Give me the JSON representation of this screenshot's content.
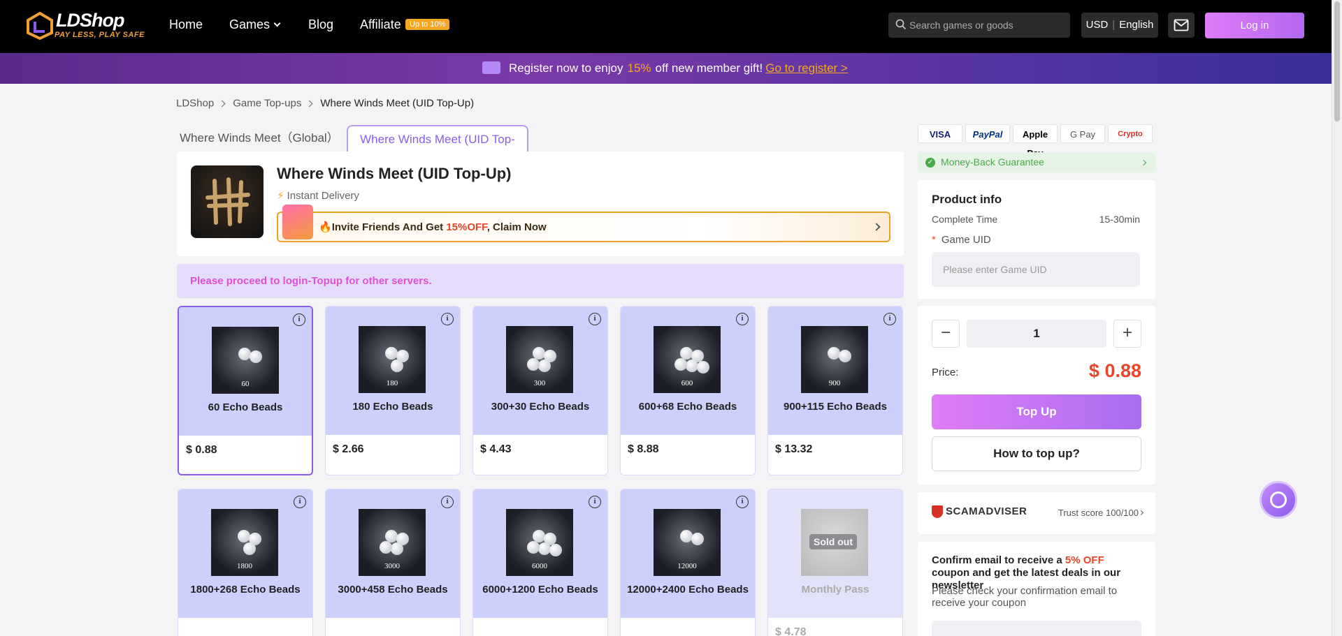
{
  "header": {
    "logo_text": "LDShop",
    "logo_tagline": "PAY LESS, PLAY SAFE",
    "nav": [
      {
        "label": "Home"
      },
      {
        "label": "Games"
      },
      {
        "label": "Blog"
      },
      {
        "label": "Affiliate"
      }
    ],
    "affiliate_badge": "Up to 10%",
    "search_placeholder": "Search games or goods",
    "currency": "USD",
    "language": "English",
    "login_label": "Log in"
  },
  "promo": {
    "text_before": "Register now to enjoy",
    "percent": "15%",
    "text_after": "off new member gift!",
    "link": "Go to register >",
    "icon": "$"
  },
  "breadcrumb": [
    "LDShop",
    "Game Top-ups",
    "Where Winds Meet (UID Top-Up)"
  ],
  "tabs": [
    {
      "label": "Where Winds Meet（Global）"
    },
    {
      "label": "Where Winds Meet (UID Top-Up)"
    }
  ],
  "product": {
    "title": "Where Winds Meet (UID Top-Up)",
    "delivery": "Instant Delivery",
    "invite_before": "Invite Friends And Get ",
    "invite_highlight": "15%OFF",
    "invite_after": ", Claim Now",
    "invite_icon": "🔥"
  },
  "notice": "Please proceed to login-Topup for other servers.",
  "packages": [
    {
      "name": "60 Echo Beads",
      "price": "$ 0.88",
      "amount": "60",
      "bonus": ""
    },
    {
      "name": "180 Echo Beads",
      "price": "$ 2.66",
      "amount": "180",
      "bonus": ""
    },
    {
      "name": "300+30 Echo Beads",
      "price": "$ 4.43",
      "amount": "300",
      "bonus": "+30"
    },
    {
      "name": "600+68 Echo Beads",
      "price": "$ 8.88",
      "amount": "600",
      "bonus": "+68"
    },
    {
      "name": "900+115 Echo Beads",
      "price": "$ 13.32",
      "amount": "900",
      "bonus": "+115"
    },
    {
      "name": "1800+268 Echo Beads",
      "price": "",
      "amount": "1800",
      "bonus": "+268"
    },
    {
      "name": "3000+458 Echo Beads",
      "price": "",
      "amount": "3000",
      "bonus": "+458"
    },
    {
      "name": "6000+1200 Echo Beads",
      "price": "",
      "amount": "6000",
      "bonus": "+1200"
    },
    {
      "name": "12000+2400 Echo Beads",
      "price": "",
      "amount": "12000",
      "bonus": "+2400"
    },
    {
      "name": "Monthly Pass",
      "price": "$ 4.78",
      "amount": "",
      "bonus": "",
      "sold_out": "Sold out"
    }
  ],
  "payments": [
    "VISA",
    "PayPal",
    "Apple Pay",
    "G Pay",
    "Crypto"
  ],
  "guarantee": "Money-Back Guarantee",
  "product_info": {
    "heading": "Product info",
    "complete_time_label": "Complete Time",
    "complete_time_value": "15-30min",
    "uid_label": "Game UID",
    "uid_placeholder": "Please enter Game UID"
  },
  "purchase": {
    "minus": "−",
    "quantity": "1",
    "plus": "+",
    "price_label": "Price:",
    "price_value": "$ 0.88",
    "topup_label": "Top Up",
    "howto_label": "How to top up?"
  },
  "scamadviser": {
    "logo": "SCAMADVISER",
    "trust": "Trust score 100/100"
  },
  "newsletter": {
    "head_before": "Confirm email to receive a ",
    "head_highlight": "5% OFF",
    "head_after": " coupon and get the latest deals in our newsletter",
    "sub": "Please check your confirmation email to receive your coupon"
  },
  "colors": {
    "accent": "#8a5cf0",
    "price_red": "#e8452a",
    "promo_orange": "#f5a623",
    "tile_bg": "#ccd0fa"
  }
}
